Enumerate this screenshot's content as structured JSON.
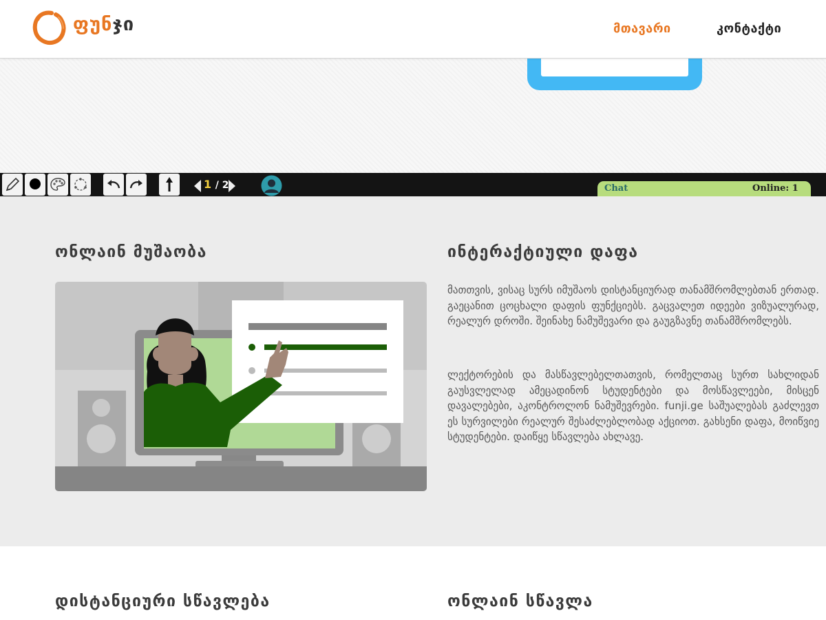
{
  "header": {
    "brand_part1": "ფუნ",
    "brand_part2": "ჯი",
    "nav": {
      "home": "მთავარი",
      "contact": "კონტაქტი"
    }
  },
  "toolbar": {
    "tools": [
      "pencil-icon",
      "brush-size-icon",
      "palette-icon",
      "shapes-icon",
      "undo-icon",
      "redo-icon",
      "pointer-icon"
    ],
    "page_current": "1",
    "page_total": "/ 2",
    "chat_label": "Chat",
    "online_label": "Online: 1"
  },
  "sections": {
    "online_work": {
      "title": "ონლაინ მუშაობა"
    },
    "interactive_board": {
      "title": "ინტერაქტიული დაფა",
      "paragraph1": "მათთვის, ვისაც სურს იმუშაოს დისტანციურად თანამშრომლებთან ერთად. გაეცანით ცოცხალი დაფის ფუნქციებს. გაცვალეთ იდეები ვიზუალურად, რეალურ დროში. შეინახე ნამუშევარი და გაუგზავნე თანამშრომლებს.",
      "paragraph2": "ლექტორების და მასწავლებელთათვის, რომელთაც სურთ სახლიდან გაუსვლელად ამეცადინონ სტუდენტები და მოსწავლეები, მისცენ დავალებები, აკონტროლონ ნამუშევრები. funji.ge საშუალებას გაძლევთ ეს სურვილები რეალურ შესაძლებლობად აქციოთ. გახსენი დაფა, მოიწვიე სტუდენტები. დაიწყე სწავლება ახლავე."
    },
    "distance_learning": {
      "title": "დისტანციური სწავლება"
    },
    "online_learning": {
      "title": "ონლაინ სწავლა"
    }
  },
  "colors": {
    "accent": "#e87722",
    "hero_screen": "#43b8f4",
    "chat_bar": "#b7dc7d",
    "toolbar_bg": "#141414"
  }
}
